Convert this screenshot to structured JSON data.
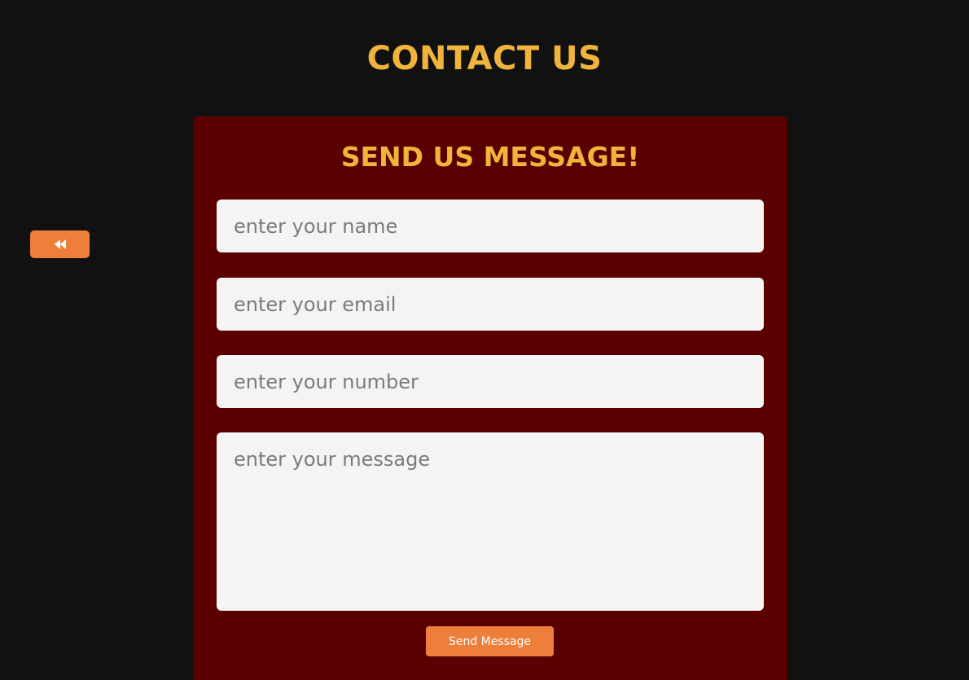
{
  "page": {
    "title": "CONTACT US"
  },
  "back_button": {
    "icon": "fast-backward-icon"
  },
  "form": {
    "heading": "SEND US MESSAGE!",
    "name_placeholder": "enter your name",
    "email_placeholder": "enter your email",
    "number_placeholder": "enter your number",
    "message_placeholder": "enter your message",
    "submit_label": "Send Message"
  },
  "colors": {
    "background": "#111111",
    "accent_title": "#f0b43c",
    "card": "#5a0000",
    "button": "#ee7f3a",
    "field": "#f4f4f4"
  }
}
